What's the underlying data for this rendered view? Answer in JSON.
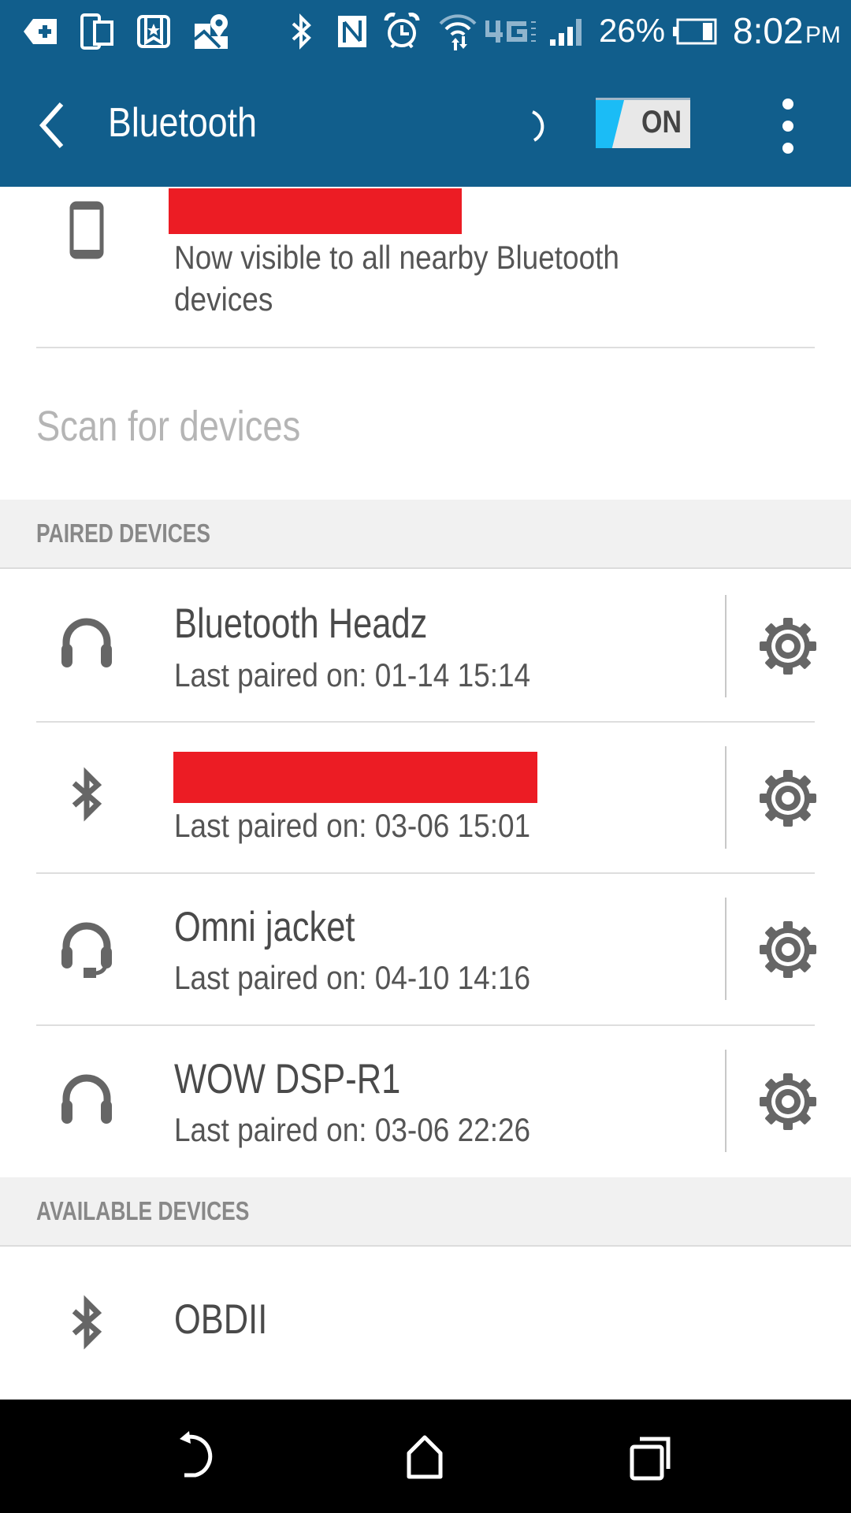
{
  "status_bar": {
    "left_icons": [
      "add-tag-icon",
      "dual-screen-icon",
      "bookmark-star-icon",
      "map-pin-icon"
    ],
    "right_icons": [
      "bluetooth-icon",
      "nfc-icon",
      "alarm-icon",
      "wifi-data-icon",
      "4g-lte-icon",
      "signal-icon"
    ],
    "battery_percent": "26%",
    "battery_level": 0.26,
    "time": "8:02",
    "ampm": "PM"
  },
  "app_bar": {
    "title": "Bluetooth",
    "toggle_label": "ON",
    "toggle_state": true
  },
  "this_device": {
    "name": "[redacted]",
    "subtitle": "Now visible to all nearby Bluetooth devices",
    "subtitle_line1": "Now visible to all nearby Bluetooth",
    "subtitle_line2": "devices"
  },
  "scan": {
    "label": "Scan for devices"
  },
  "paired": {
    "header": "PAIRED DEVICES",
    "devices": [
      {
        "name": "Bluetooth Headz",
        "subtitle": "Last paired on: 01-14 15:14",
        "icon": "headphones-icon",
        "redacted": false
      },
      {
        "name": "[redacted]",
        "subtitle": "Last paired on: 03-06 15:01",
        "icon": "bluetooth-icon",
        "redacted": true
      },
      {
        "name": "Omni jacket",
        "subtitle": "Last paired on: 04-10 14:16",
        "icon": "headset-icon",
        "redacted": false
      },
      {
        "name": "WOW DSP-R1",
        "subtitle": "Last paired on: 03-06 22:26",
        "icon": "headphones-icon",
        "redacted": false
      }
    ]
  },
  "available": {
    "header": "AVAILABLE DEVICES",
    "devices": [
      {
        "name": "OBDII",
        "icon": "bluetooth-icon"
      }
    ]
  },
  "nav_bar": {
    "buttons": [
      "back",
      "home",
      "recents"
    ]
  },
  "colors": {
    "header_bg": "#115e8c",
    "toggle_accent": "#1bbcf6",
    "redaction": "#ec1c24",
    "section_bg": "#f1f1f1"
  }
}
